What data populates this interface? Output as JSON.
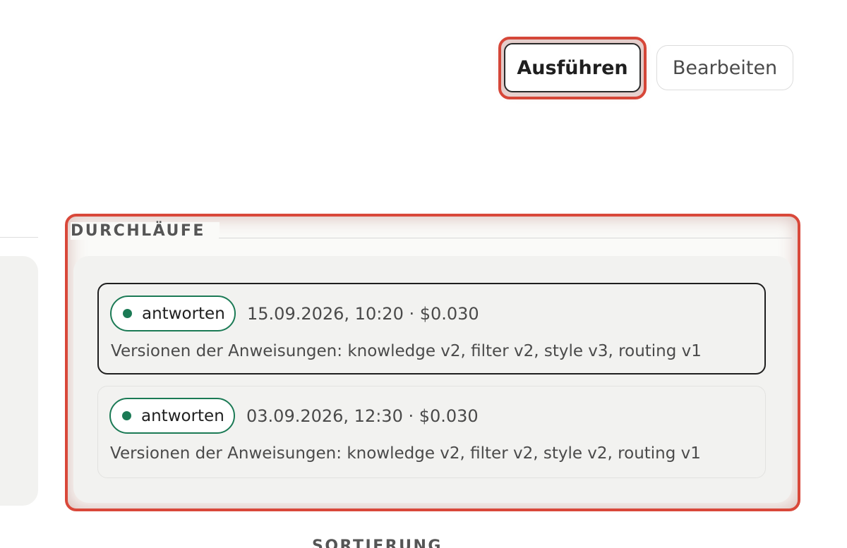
{
  "toolbar": {
    "run_label": "Ausführen",
    "edit_label": "Bearbeiten"
  },
  "runs": {
    "heading": "DURCHLÄUFE",
    "items": [
      {
        "status": "antworten",
        "meta": "15.09.2026, 10:20 · $0.030",
        "versions": "Versionen der Anweisungen: knowledge v2, filter v2, style v3, routing v1"
      },
      {
        "status": "antworten",
        "meta": "03.09.2026, 12:30 · $0.030",
        "versions": "Versionen der Anweisungen: knowledge v2, filter v2, style v2, routing v1"
      }
    ]
  },
  "sort": {
    "heading": "SORTIERUNG"
  },
  "colors": {
    "highlight": "#d9483a",
    "status_green": "#1b7a55",
    "panel_bg": "#f2f2f0"
  }
}
